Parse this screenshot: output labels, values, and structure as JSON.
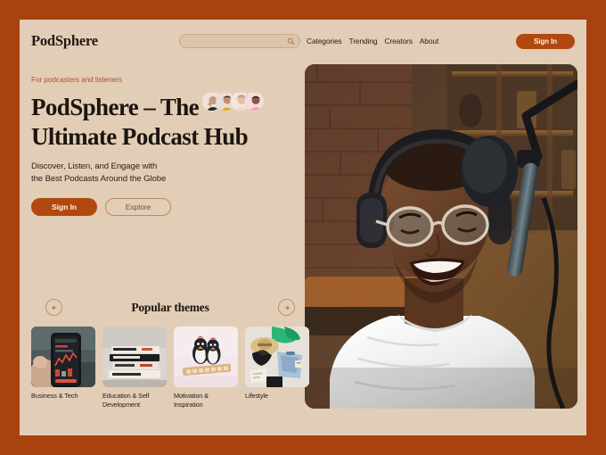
{
  "theme": {
    "frame_color": "#a8430f",
    "page_bg": "#e2cdb7",
    "accent": "#b1480f",
    "text_dark": "#1c150f",
    "muted": "#a8542c"
  },
  "header": {
    "logo": "PodSphere",
    "search": {
      "value": "",
      "placeholder": "",
      "icon": "search-icon"
    },
    "nav": [
      {
        "label": "Categories"
      },
      {
        "label": "Trending"
      },
      {
        "label": "Creators"
      },
      {
        "label": "About"
      }
    ],
    "sign_in_label": "Sign In"
  },
  "hero": {
    "eyebrow": "For podcasters and listeners",
    "headline_part1": "PodSphere – The",
    "headline_part2": "Ultimate Podcast Hub",
    "subhead_line1": "Discover, Listen, and Engage with",
    "subhead_line2": "the Best Podcasts Around the Globe",
    "primary_cta": "Sign In",
    "secondary_cta": "Explore",
    "avatars": [
      {
        "name": "avatar-1",
        "bg": "#efe2da",
        "skin": "#c89a80",
        "cloth": "#2a2a2e"
      },
      {
        "name": "avatar-2",
        "bg": "#e8ded8",
        "skin": "#c08d6c",
        "cloth": "#e0a92a"
      },
      {
        "name": "avatar-3",
        "bg": "#f2e6df",
        "skin": "#e2bfa4",
        "cloth": "#efd9c9"
      },
      {
        "name": "avatar-4",
        "bg": "#f6dce0",
        "skin": "#8a5a3c",
        "cloth": "#f0a8a8"
      }
    ],
    "image_alt": "Smiling man wearing headphones and glasses speaking into a studio microphone"
  },
  "themes": {
    "title": "Popular themes",
    "prev_label": "Previous",
    "next_label": "Next",
    "cards": [
      {
        "label": "Business & Tech",
        "thumb": "phone-stock-chart"
      },
      {
        "label": "Education & Self Development",
        "thumb": "stack-of-books"
      },
      {
        "label": "Motivation & Inspiration",
        "thumb": "penguin-figurines"
      },
      {
        "label": "Lifestyle",
        "thumb": "travel-flatlay"
      }
    ]
  }
}
